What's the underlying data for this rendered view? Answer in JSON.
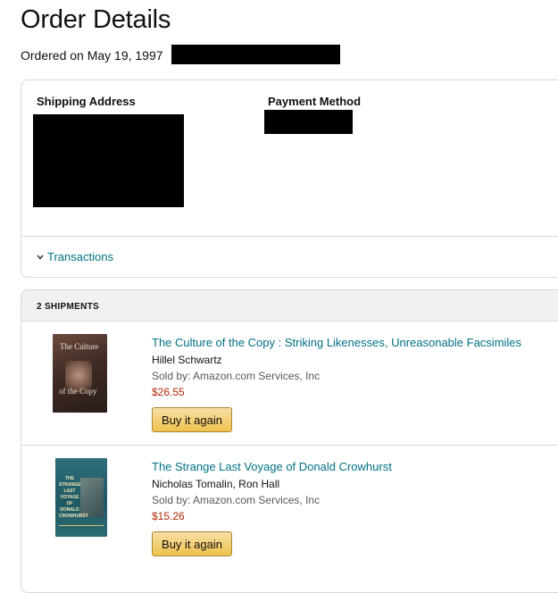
{
  "page": {
    "title": "Order Details",
    "ordered_on": "Ordered on May 19, 1997"
  },
  "summary": {
    "shipping_label": "Shipping Address",
    "payment_label": "Payment Method",
    "transactions_label": "Transactions"
  },
  "shipments": {
    "header": "2 SHIPMENTS",
    "items": [
      {
        "title": "The Culture of the Copy : Striking Likenesses, Unreasonable Facsimiles",
        "author": "Hillel Schwartz",
        "seller": "Sold by: Amazon.com Services, Inc",
        "price": "$26.55",
        "button": "Buy it again",
        "cover_text_top": "The Culture",
        "cover_text_bottom": "of the Copy"
      },
      {
        "title": "The Strange Last Voyage of Donald Crowhurst",
        "author": "Nicholas Tomalin, Ron Hall",
        "seller": "Sold by: Amazon.com Services, Inc",
        "price": "$15.26",
        "button": "Buy it again",
        "cover_text": "THE STRANGE LAST VOYAGE OF DONALD CROWHURST"
      }
    ]
  },
  "colors": {
    "link": "#007185",
    "price": "#b12704",
    "button_top": "#f7dfa5",
    "button_bottom": "#f0c14b",
    "header_bg": "#f0f2f2",
    "border": "#d5d9d9"
  },
  "icons": {
    "transactions_toggle": "chevron-down-icon"
  }
}
